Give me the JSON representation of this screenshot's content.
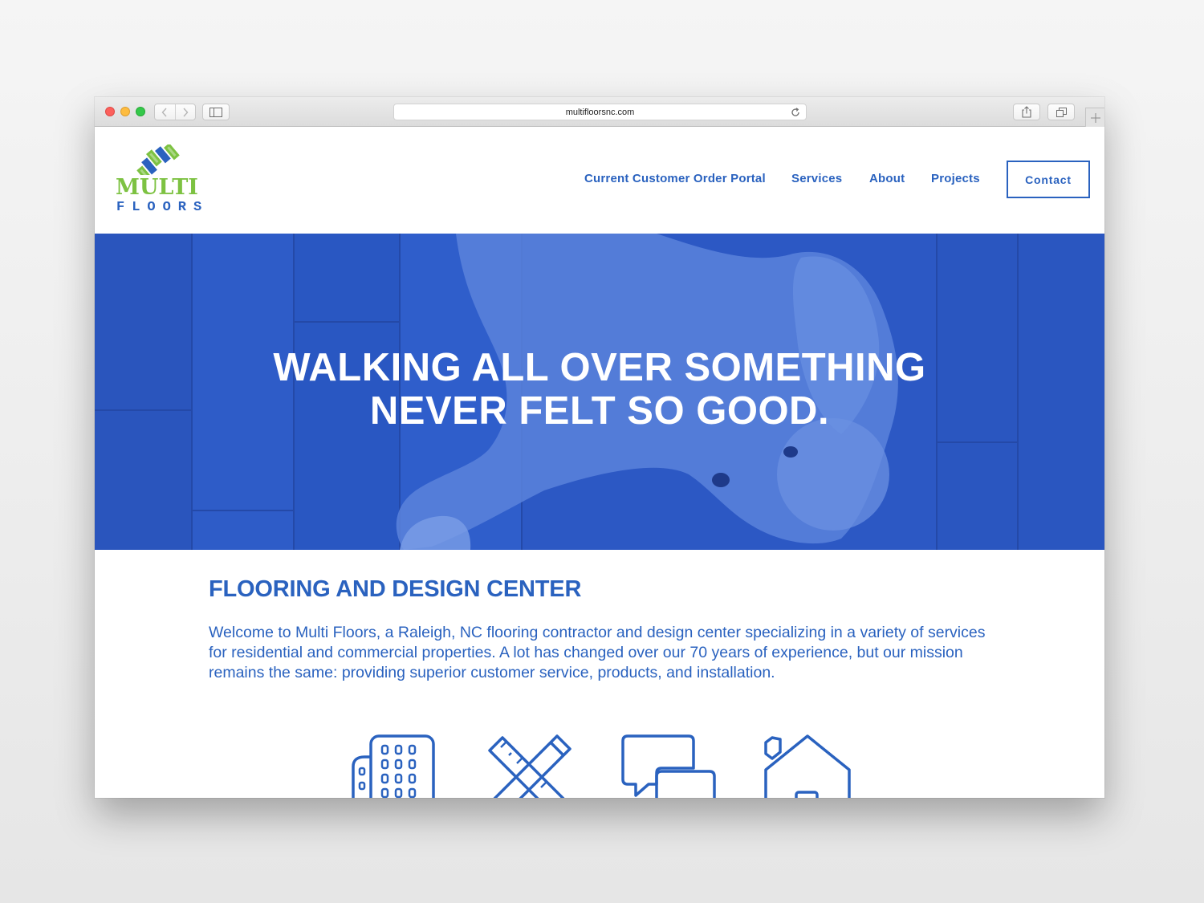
{
  "browser": {
    "url": "multifloorsnc.com"
  },
  "logo": {
    "line1": "MULTI",
    "line2": "FLOORS",
    "colors": {
      "green": "#7dc242",
      "blue": "#2a62bf"
    }
  },
  "nav": {
    "items": [
      {
        "label": "Current Customer Order Portal"
      },
      {
        "label": "Services"
      },
      {
        "label": "About"
      },
      {
        "label": "Projects"
      }
    ],
    "contact_label": "Contact"
  },
  "hero": {
    "line1": "WALKING ALL OVER SOMETHING",
    "line2": "NEVER FELT SO GOOD.",
    "overlay_color": "#2d5bc8"
  },
  "main": {
    "title": "FLOORING AND DESIGN CENTER",
    "intro": "Welcome to Multi Floors, a Raleigh, NC flooring contractor and design center specializing in a variety of services for residential and commercial properties. A lot has changed over our 70 years of experience, but our mission remains the same: providing superior customer service, products, and installation."
  },
  "service_icons": [
    {
      "icon": "commercial-building-icon"
    },
    {
      "icon": "design-tools-icon"
    },
    {
      "icon": "consultation-chat-icon"
    },
    {
      "icon": "residential-house-icon"
    }
  ],
  "theme": {
    "accent": "#2a62bf"
  }
}
